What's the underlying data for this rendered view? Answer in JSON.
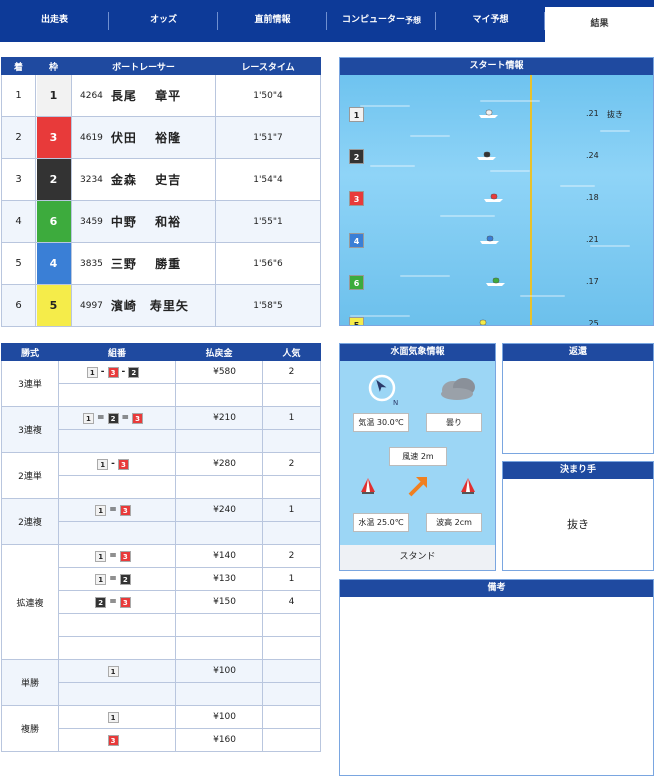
{
  "nav": [
    {
      "label": "出走表"
    },
    {
      "label": "オッズ"
    },
    {
      "label": "直前情報"
    },
    {
      "label": "コンピューター",
      "sub": "予想"
    },
    {
      "label": "マイ予想"
    },
    {
      "label": "結果"
    }
  ],
  "racers_table": {
    "headers": [
      "着",
      "枠",
      "ボートレーサー",
      "レースタイム"
    ],
    "rows": [
      {
        "rank": "1",
        "frame": "1",
        "id": "4264",
        "name": "長尾　 章平",
        "time": "1'50\"4"
      },
      {
        "rank": "2",
        "frame": "3",
        "id": "4619",
        "name": "伏田　 裕隆",
        "time": "1'51\"7"
      },
      {
        "rank": "3",
        "frame": "2",
        "id": "3234",
        "name": "金森　 史吉",
        "time": "1'54\"4"
      },
      {
        "rank": "4",
        "frame": "6",
        "id": "3459",
        "name": "中野　 和裕",
        "time": "1'55\"1"
      },
      {
        "rank": "5",
        "frame": "4",
        "id": "3835",
        "name": "三野　 勝重",
        "time": "1'56\"6"
      },
      {
        "rank": "6",
        "frame": "5",
        "id": "4997",
        "name": "濱崎　寿里矢",
        "time": "1'58\"5"
      }
    ]
  },
  "frame_colors": {
    "1": "#f2f2f2",
    "2": "#333333",
    "3": "#e83a3a",
    "4": "#3a7fd6",
    "5": "#f5ec4a",
    "6": "#3dab3d"
  },
  "start_info": {
    "title": "スタート情報",
    "rows": [
      {
        "frame": "1",
        "time": ".21",
        "note": "抜き"
      },
      {
        "frame": "2",
        "time": ".24",
        "note": ""
      },
      {
        "frame": "3",
        "time": ".18",
        "note": ""
      },
      {
        "frame": "4",
        "time": ".21",
        "note": ""
      },
      {
        "frame": "6",
        "time": ".17",
        "note": ""
      },
      {
        "frame": "5",
        "time": ".25",
        "note": ""
      }
    ]
  },
  "payout_table": {
    "headers": [
      "勝式",
      "組番",
      "払戻金",
      "人気"
    ],
    "groups": [
      {
        "kind": "3連単",
        "rows": [
          {
            "combo": [
              "1",
              "-",
              "3",
              "-",
              "2"
            ],
            "amount": "¥580",
            "pop": "2"
          },
          null
        ]
      },
      {
        "kind": "3連複",
        "rows": [
          {
            "combo": [
              "1",
              "=",
              "2",
              "=",
              "3"
            ],
            "amount": "¥210",
            "pop": "1"
          },
          null
        ]
      },
      {
        "kind": "2連単",
        "rows": [
          {
            "combo": [
              "1",
              "-",
              "3"
            ],
            "amount": "¥280",
            "pop": "2"
          },
          null
        ]
      },
      {
        "kind": "2連複",
        "rows": [
          {
            "combo": [
              "1",
              "=",
              "3"
            ],
            "amount": "¥240",
            "pop": "1"
          },
          null
        ]
      },
      {
        "kind": "拡連複",
        "rows": [
          {
            "combo": [
              "1",
              "=",
              "3"
            ],
            "amount": "¥140",
            "pop": "2"
          },
          {
            "combo": [
              "1",
              "=",
              "2"
            ],
            "amount": "¥130",
            "pop": "1"
          },
          {
            "combo": [
              "2",
              "=",
              "3"
            ],
            "amount": "¥150",
            "pop": "4"
          },
          null,
          null
        ]
      },
      {
        "kind": "単勝",
        "rows": [
          {
            "combo": [
              "1"
            ],
            "amount": "¥100",
            "pop": ""
          },
          null
        ]
      },
      {
        "kind": "複勝",
        "rows": [
          {
            "combo": [
              "1"
            ],
            "amount": "¥100",
            "pop": ""
          },
          {
            "combo": [
              "3"
            ],
            "amount": "¥160",
            "pop": ""
          }
        ]
      }
    ]
  },
  "weather": {
    "title": "水面気象情報",
    "temperature": "気温 30.0℃",
    "condition": "曇り",
    "wind_speed": "風速 2m",
    "water_temp": "水温 25.0℃",
    "wave": "波高 2cm",
    "compass_label": "N",
    "stand": "スタンド"
  },
  "refund": {
    "title": "返還"
  },
  "kimarite": {
    "title": "決まり手",
    "value": "抜き"
  },
  "remarks": {
    "title": "備考"
  }
}
